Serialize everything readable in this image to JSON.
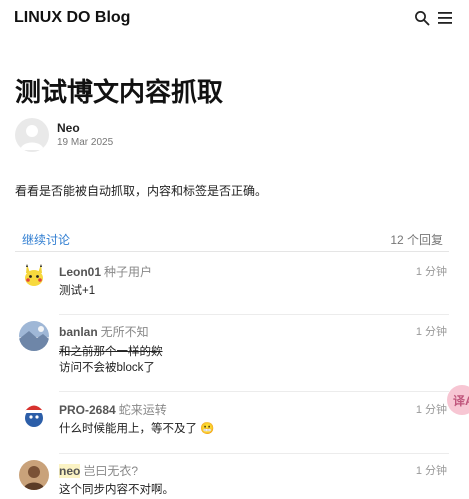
{
  "header": {
    "brand": "LINUX DO Blog",
    "search_icon": "search-icon",
    "menu_icon": "hamburger-menu-icon"
  },
  "post": {
    "title": "测试博文内容抓取",
    "author": "Neo",
    "date": "19 Mar 2025",
    "body": "看看是否能被自动抓取，内容和标签是否正确。"
  },
  "comments_header": {
    "continue_label": "继续讨论",
    "reply_count": "12 个回复"
  },
  "comments": [
    {
      "user": "Leon01",
      "title": "种子用户",
      "time": "1 分钟",
      "lines": [
        "测试+1"
      ],
      "avatar": "pikachu-avatar"
    },
    {
      "user": "banlan",
      "title": "无所不知",
      "time": "1 分钟",
      "lines": [
        "和之前那个一样的欸",
        "访问不会被block了"
      ],
      "avatar": "landscape-avatar"
    },
    {
      "user": "PRO-2684",
      "title": "蛇来运转",
      "time": "1 分钟",
      "lines": [
        "什么时候能用上，等不及了"
      ],
      "emoji": "😬",
      "avatar": "santa-hat-avatar"
    },
    {
      "user": "neo",
      "title": "岂曰无衣?",
      "time": "1 分钟",
      "lines": [
        "这个同步内容不对啊。"
      ],
      "avatar": "photo-avatar"
    }
  ],
  "translate_fab": {
    "label": "译A",
    "icon": "translate-icon"
  },
  "colors": {
    "link": "#2f7dd1",
    "fab": "#f7c6d3"
  }
}
